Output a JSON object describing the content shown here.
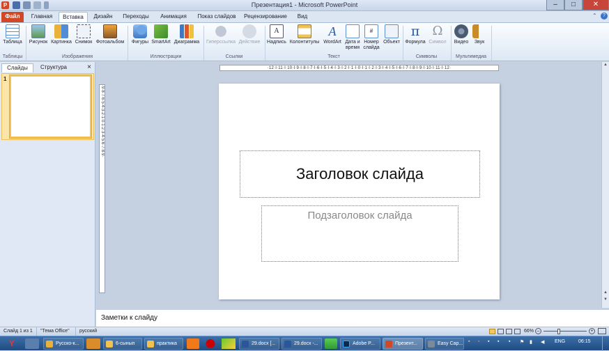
{
  "window": {
    "title": "Презентация1 - Microsoft PowerPoint",
    "app_icon": "P"
  },
  "tabs": [
    "Файл",
    "Главная",
    "Вставка",
    "Дизайн",
    "Переходы",
    "Анимация",
    "Показ слайдов",
    "Рецензирование",
    "Вид"
  ],
  "active_tab": "Вставка",
  "ribbon": {
    "tables": {
      "label": "Таблица",
      "group": "Таблицы"
    },
    "images": {
      "items": [
        "Рисунок",
        "Картинка",
        "Снимок",
        "Фотоальбом"
      ],
      "group": "Изображения"
    },
    "illustrations": {
      "items": [
        "Фигуры",
        "SmartArt",
        "Диаграмма"
      ],
      "group": "Иллюстрации"
    },
    "links": {
      "items": [
        "Гиперссылка",
        "Действие"
      ],
      "group": "Ссылки"
    },
    "text": {
      "items": [
        "Надпись",
        "Колонтитулы",
        "WordArt",
        "Дата и время",
        "Номер слайда",
        "Объект"
      ],
      "group": "Текст"
    },
    "symbols": {
      "items": [
        "Формула",
        "Символ"
      ],
      "group": "Символы"
    },
    "media": {
      "items": [
        "Видео",
        "Звук"
      ],
      "group": "Мультимедиа"
    }
  },
  "pane_tabs": {
    "slides": "Слайды",
    "outline": "Структура",
    "close": "×"
  },
  "slide_number": "1",
  "ruler": {
    "h": "·12·I·11·I·10·I·9·I·8·I·7·I·6·I·5·I·4·I·3·I·2·I·1·I·0·I·1·I·2·I·3·I·4·I·5·I·6·I·7·I·8·I·9·I·10·I·11·I·12·",
    "v": "·9·8·7·6·5·4·3·2·1·0·1·2·3·4·5·6·7·8·9·"
  },
  "slide": {
    "title_placeholder": "Заголовок слайда",
    "subtitle_placeholder": "Подзаголовок слайда"
  },
  "notes_placeholder": "Заметки к слайду",
  "status": {
    "slide_info": "Слайд 1 из 1",
    "theme": "\"Тема Office\"",
    "language": "русский",
    "zoom": "66%"
  },
  "taskbar": {
    "items": [
      "Русско-к...",
      "6-сынып",
      "практика",
      "29.docx [...",
      "29.docx -...",
      "Adobe P...",
      "Презент...",
      "Easy Cap..."
    ],
    "lang": "ENG",
    "clock": "06:15"
  },
  "colors": {
    "file_tab": "#d24726",
    "accent": "#2b579a"
  }
}
